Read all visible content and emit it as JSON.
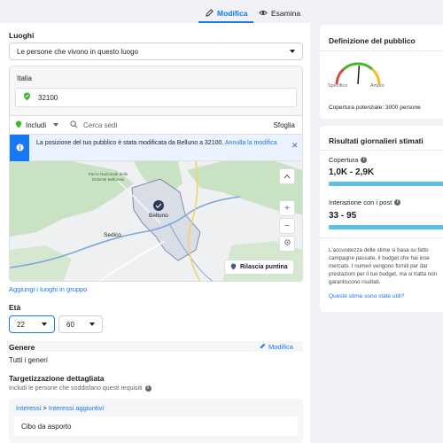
{
  "tabs": [
    {
      "label": "Modifica",
      "icon": "pencil-icon",
      "active": true
    },
    {
      "label": "Esamina",
      "icon": "eye-icon",
      "active": false
    }
  ],
  "locations": {
    "title": "Luoghi",
    "mode_select": "Le persone che vivono in questo luogo",
    "country": "Italia",
    "postal_code": "32100",
    "include_label": "Includi",
    "search_placeholder": "Cerca sedi",
    "browse_label": "Sfoglia",
    "info_text": "La posizione del tuo pubblico è stata modificata da Belluno a 32100.",
    "info_link": "Annulla la modifica",
    "map_labels": {
      "park": "Parco Nazionale delle Dolomiti Bellunesi",
      "city": "Belluno",
      "town": "Sedico"
    },
    "drop_pin": "Rilascia puntina",
    "add_in_group": "Aggiungi i luoghi in gruppo"
  },
  "age": {
    "title": "Età",
    "min": "22",
    "max": "60"
  },
  "gender": {
    "title": "Genere",
    "edit": "Modifica",
    "value": "Tutti i generi"
  },
  "detailed_targeting": {
    "title": "Targetizzazione dettagliata",
    "subtitle": "Includi le persone che soddisfano questi requisiti",
    "breadcrumb_root": "Interessi",
    "breadcrumb_sep": " > ",
    "breadcrumb_child": "Interessi aggiuntivi",
    "item": "Cibo da asporto"
  },
  "audience_definition": {
    "title": "Definizione del pubblico",
    "gauge_left": "Specifico",
    "gauge_right": "Ampio",
    "gauge_level": 0.52,
    "potential": "Copertura potenziale: 3000 persone"
  },
  "daily_results": {
    "title": "Risultati giornalieri stimati",
    "reach_label": "Copertura",
    "reach_value": "1,0K - 2,9K",
    "engagement_label": "Interazione con i post",
    "engagement_value": "33 - 95",
    "disclaimer": "L'accuratezza delle stime si basa su fatto campagne passate, il budget che hai inse mercato. I numeri vengono forniti per dar prestazioni per il tuo budget, ma si tratta non garantiscono risultati.",
    "link": "Queste stime sono state utili?"
  },
  "colors": {
    "accent": "#1877f2",
    "bar": "#5ac1e0",
    "success": "#42b72a"
  }
}
